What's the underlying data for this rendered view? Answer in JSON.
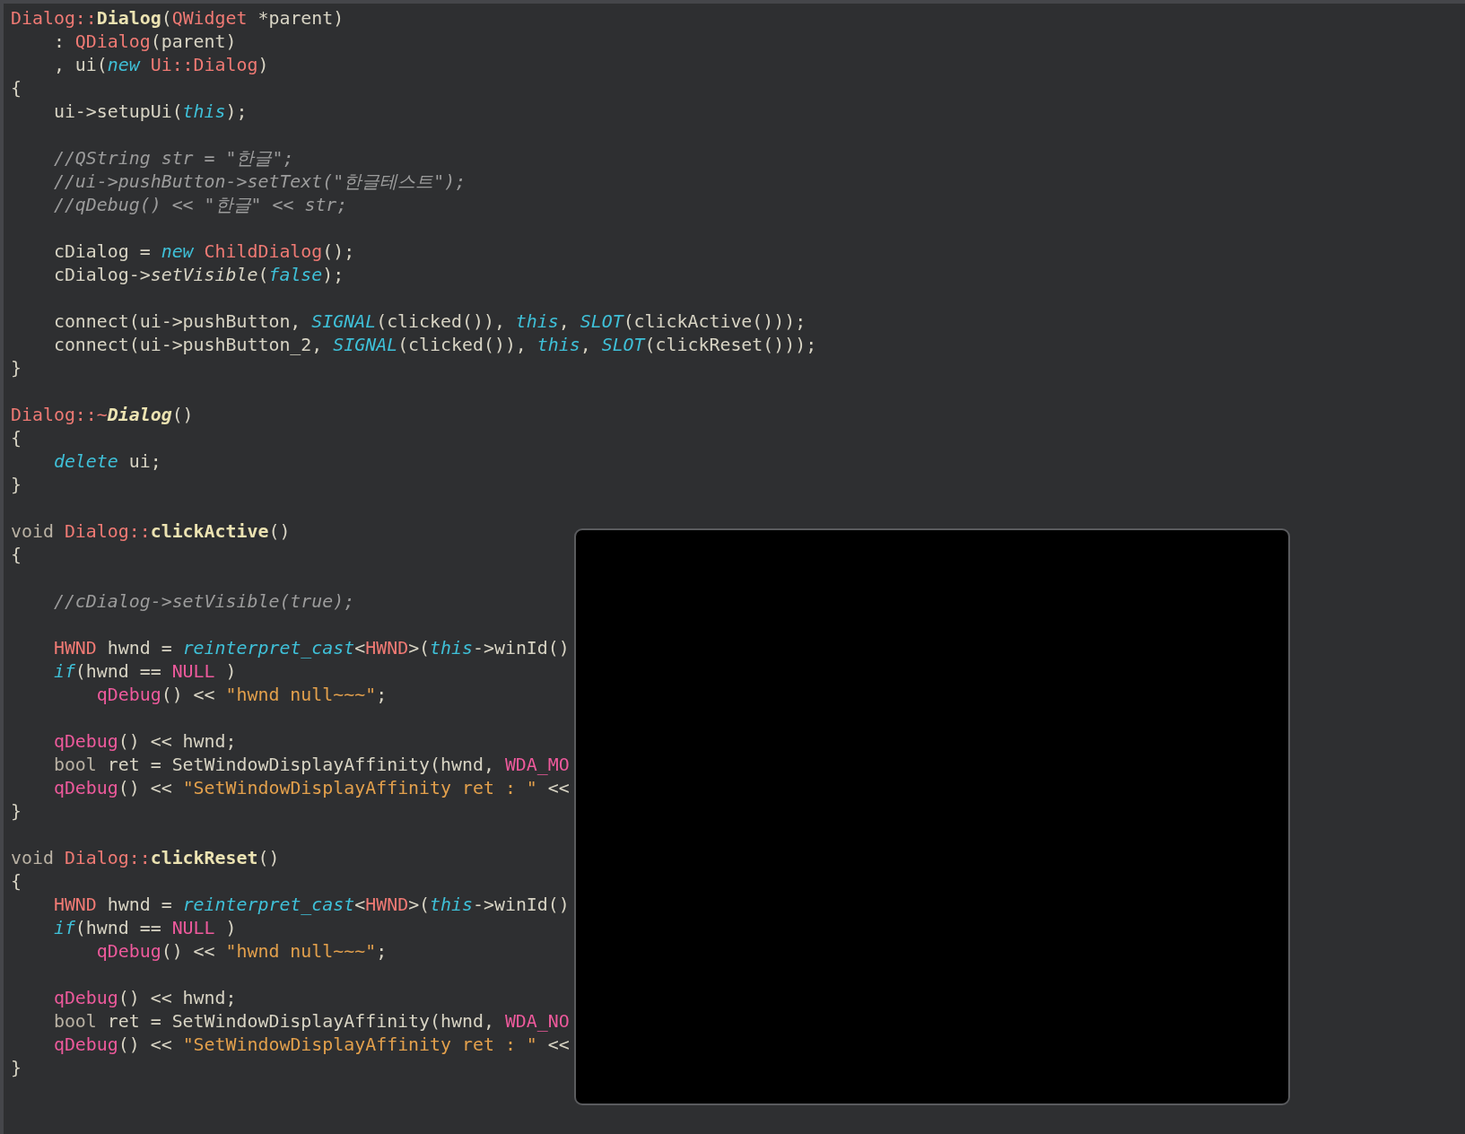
{
  "editor": {
    "lines": [
      {
        "kind": "code",
        "tokens": [
          {
            "kind": "type",
            "text": "Dialog::"
          },
          {
            "kind": "func",
            "text": "Dialog"
          },
          {
            "kind": "plain",
            "text": "("
          },
          {
            "kind": "type",
            "text": "QWidget"
          },
          {
            "kind": "plain",
            "text": " *parent)"
          }
        ]
      },
      {
        "kind": "code",
        "tokens": [
          {
            "kind": "plain",
            "text": "    : "
          },
          {
            "kind": "type",
            "text": "QDialog"
          },
          {
            "kind": "plain",
            "text": "(parent)"
          }
        ]
      },
      {
        "kind": "code",
        "tokens": [
          {
            "kind": "plain",
            "text": "    , ui("
          },
          {
            "kind": "keyword",
            "text": "new"
          },
          {
            "kind": "type",
            "text": " Ui::Dialog"
          },
          {
            "kind": "plain",
            "text": ")"
          }
        ]
      },
      {
        "kind": "code",
        "tokens": [
          {
            "kind": "plain",
            "text": "{"
          }
        ]
      },
      {
        "kind": "code",
        "tokens": [
          {
            "kind": "plain",
            "text": "    ui->setupUi("
          },
          {
            "kind": "keyword",
            "text": "this"
          },
          {
            "kind": "plain",
            "text": ");"
          }
        ]
      },
      {
        "kind": "blank"
      },
      {
        "kind": "code",
        "tokens": [
          {
            "kind": "comment",
            "text": "    //QString str = \"한글\";"
          }
        ]
      },
      {
        "kind": "code",
        "tokens": [
          {
            "kind": "comment",
            "text": "    //ui->pushButton->setText(\"한글테스트\");"
          }
        ]
      },
      {
        "kind": "code",
        "tokens": [
          {
            "kind": "comment",
            "text": "    //qDebug() << \"한글\" << str;"
          }
        ]
      },
      {
        "kind": "blank"
      },
      {
        "kind": "code",
        "tokens": [
          {
            "kind": "plain",
            "text": "    cDialog = "
          },
          {
            "kind": "keyword",
            "text": "new"
          },
          {
            "kind": "type",
            "text": " ChildDialog"
          },
          {
            "kind": "plain",
            "text": "();"
          }
        ]
      },
      {
        "kind": "code",
        "tokens": [
          {
            "kind": "plain",
            "text": "    cDialog->"
          },
          {
            "kind": "method",
            "text": "setVisible"
          },
          {
            "kind": "plain",
            "text": "("
          },
          {
            "kind": "keyword",
            "text": "false"
          },
          {
            "kind": "plain",
            "text": ");"
          }
        ]
      },
      {
        "kind": "blank"
      },
      {
        "kind": "code",
        "tokens": [
          {
            "kind": "plain",
            "text": "    connect(ui->pushButton, "
          },
          {
            "kind": "keyword",
            "text": "SIGNAL"
          },
          {
            "kind": "plain",
            "text": "(clicked()), "
          },
          {
            "kind": "keyword",
            "text": "this"
          },
          {
            "kind": "plain",
            "text": ", "
          },
          {
            "kind": "keyword",
            "text": "SLOT"
          },
          {
            "kind": "plain",
            "text": "(clickActive()));"
          }
        ]
      },
      {
        "kind": "code",
        "tokens": [
          {
            "kind": "plain",
            "text": "    connect(ui->pushButton_2, "
          },
          {
            "kind": "keyword",
            "text": "SIGNAL"
          },
          {
            "kind": "plain",
            "text": "(clicked()), "
          },
          {
            "kind": "keyword",
            "text": "this"
          },
          {
            "kind": "plain",
            "text": ", "
          },
          {
            "kind": "keyword",
            "text": "SLOT"
          },
          {
            "kind": "plain",
            "text": "(clickReset()));"
          }
        ]
      },
      {
        "kind": "code",
        "tokens": [
          {
            "kind": "plain",
            "text": "}"
          }
        ]
      },
      {
        "kind": "blank"
      },
      {
        "kind": "code",
        "tokens": [
          {
            "kind": "type",
            "text": "Dialog::~"
          },
          {
            "kind": "dtor",
            "text": "Dialog"
          },
          {
            "kind": "plain",
            "text": "()"
          }
        ]
      },
      {
        "kind": "code",
        "tokens": [
          {
            "kind": "plain",
            "text": "{"
          }
        ]
      },
      {
        "kind": "code",
        "tokens": [
          {
            "kind": "keyword",
            "text": "    delete"
          },
          {
            "kind": "plain",
            "text": " ui;"
          }
        ]
      },
      {
        "kind": "code",
        "tokens": [
          {
            "kind": "plain",
            "text": "}"
          }
        ]
      },
      {
        "kind": "blank"
      },
      {
        "kind": "code",
        "tokens": [
          {
            "kind": "storage",
            "text": "void"
          },
          {
            "kind": "type",
            "text": " Dialog::"
          },
          {
            "kind": "func",
            "text": "clickActive"
          },
          {
            "kind": "plain",
            "text": "()"
          }
        ]
      },
      {
        "kind": "code",
        "tokens": [
          {
            "kind": "plain",
            "text": "{"
          }
        ]
      },
      {
        "kind": "blank"
      },
      {
        "kind": "code",
        "tokens": [
          {
            "kind": "comment",
            "text": "    //cDialog->setVisible(true);"
          }
        ]
      },
      {
        "kind": "blank"
      },
      {
        "kind": "code",
        "tokens": [
          {
            "kind": "type",
            "text": "    HWND"
          },
          {
            "kind": "plain",
            "text": " hwnd = "
          },
          {
            "kind": "keyword",
            "text": "reinterpret_cast"
          },
          {
            "kind": "plain",
            "text": "<"
          },
          {
            "kind": "type",
            "text": "HWND"
          },
          {
            "kind": "plain",
            "text": ">("
          },
          {
            "kind": "keyword",
            "text": "this"
          },
          {
            "kind": "plain",
            "text": "->winId()"
          }
        ]
      },
      {
        "kind": "code",
        "tokens": [
          {
            "kind": "keyword",
            "text": "    if"
          },
          {
            "kind": "plain",
            "text": "(hwnd == "
          },
          {
            "kind": "call",
            "text": "NULL"
          },
          {
            "kind": "plain",
            "text": " )"
          }
        ]
      },
      {
        "kind": "code",
        "tokens": [
          {
            "kind": "call",
            "text": "        qDebug"
          },
          {
            "kind": "plain",
            "text": "() << "
          },
          {
            "kind": "string",
            "text": "\"hwnd null~~~\""
          },
          {
            "kind": "plain",
            "text": ";"
          }
        ]
      },
      {
        "kind": "blank"
      },
      {
        "kind": "code",
        "tokens": [
          {
            "kind": "call",
            "text": "    qDebug"
          },
          {
            "kind": "plain",
            "text": "() << hwnd;"
          }
        ]
      },
      {
        "kind": "code",
        "tokens": [
          {
            "kind": "storage",
            "text": "    bool"
          },
          {
            "kind": "plain",
            "text": " ret = SetWindowDisplayAffinity(hwnd, "
          },
          {
            "kind": "call",
            "text": "WDA_MO"
          }
        ]
      },
      {
        "kind": "code",
        "tokens": [
          {
            "kind": "call",
            "text": "    qDebug"
          },
          {
            "kind": "plain",
            "text": "() << "
          },
          {
            "kind": "string",
            "text": "\"SetWindowDisplayAffinity ret : \""
          },
          {
            "kind": "plain",
            "text": " <<"
          }
        ]
      },
      {
        "kind": "code",
        "tokens": [
          {
            "kind": "plain",
            "text": "}"
          }
        ]
      },
      {
        "kind": "blank"
      },
      {
        "kind": "code",
        "tokens": [
          {
            "kind": "storage",
            "text": "void"
          },
          {
            "kind": "type",
            "text": " Dialog::"
          },
          {
            "kind": "func",
            "text": "clickReset"
          },
          {
            "kind": "plain",
            "text": "()"
          }
        ]
      },
      {
        "kind": "code",
        "tokens": [
          {
            "kind": "plain",
            "text": "{"
          }
        ]
      },
      {
        "kind": "code",
        "tokens": [
          {
            "kind": "type",
            "text": "    HWND"
          },
          {
            "kind": "plain",
            "text": " hwnd = "
          },
          {
            "kind": "keyword",
            "text": "reinterpret_cast"
          },
          {
            "kind": "plain",
            "text": "<"
          },
          {
            "kind": "type",
            "text": "HWND"
          },
          {
            "kind": "plain",
            "text": ">("
          },
          {
            "kind": "keyword",
            "text": "this"
          },
          {
            "kind": "plain",
            "text": "->winId()"
          }
        ]
      },
      {
        "kind": "code",
        "tokens": [
          {
            "kind": "keyword",
            "text": "    if"
          },
          {
            "kind": "plain",
            "text": "(hwnd == "
          },
          {
            "kind": "call",
            "text": "NULL"
          },
          {
            "kind": "plain",
            "text": " )"
          }
        ]
      },
      {
        "kind": "code",
        "tokens": [
          {
            "kind": "call",
            "text": "        qDebug"
          },
          {
            "kind": "plain",
            "text": "() << "
          },
          {
            "kind": "string",
            "text": "\"hwnd null~~~\""
          },
          {
            "kind": "plain",
            "text": ";"
          }
        ]
      },
      {
        "kind": "blank"
      },
      {
        "kind": "code",
        "tokens": [
          {
            "kind": "call",
            "text": "    qDebug"
          },
          {
            "kind": "plain",
            "text": "() << hwnd;"
          }
        ]
      },
      {
        "kind": "code",
        "tokens": [
          {
            "kind": "storage",
            "text": "    bool"
          },
          {
            "kind": "plain",
            "text": " ret = SetWindowDisplayAffinity(hwnd, "
          },
          {
            "kind": "call",
            "text": "WDA_NO"
          }
        ]
      },
      {
        "kind": "code",
        "tokens": [
          {
            "kind": "call",
            "text": "    qDebug"
          },
          {
            "kind": "plain",
            "text": "() << "
          },
          {
            "kind": "string",
            "text": "\"SetWindowDisplayAffinity ret : \""
          },
          {
            "kind": "plain",
            "text": " <<"
          }
        ]
      },
      {
        "kind": "code",
        "tokens": [
          {
            "kind": "plain",
            "text": "}"
          }
        ]
      }
    ]
  },
  "overlay_window": {
    "kind": "blank-window"
  }
}
